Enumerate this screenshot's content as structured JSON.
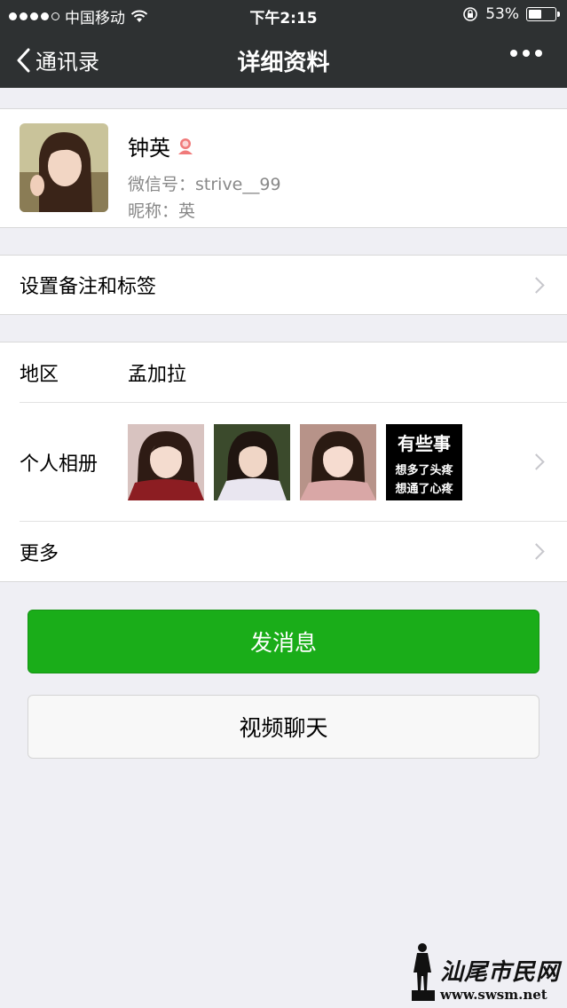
{
  "status_bar": {
    "carrier": "中国移动",
    "time": "下午2:15",
    "battery": "53%",
    "battery_level": 0.53
  },
  "nav": {
    "back_label": "通讯录",
    "title": "详细资料",
    "more_icon": "more-dots-icon"
  },
  "profile": {
    "name": "钟英",
    "wechat_id": "微信号：strive__99",
    "nickname": "昵称：英",
    "gender_icon": "female-icon"
  },
  "rows": {
    "remark_label": "设置备注和标签",
    "region_label": "地区",
    "region_value": "孟加拉",
    "album_label": "个人相册",
    "more_label": "更多"
  },
  "album_text_image": {
    "line1": "有些事",
    "line2": "想多了头疼",
    "line3": "想通了心疼"
  },
  "buttons": {
    "send_message": "发消息",
    "video_chat": "视频聊天"
  },
  "watermark": {
    "site_name": "汕尾市民网",
    "url": "www.swsm.net"
  },
  "colors": {
    "nav_bg": "#2e3132",
    "primary_green": "#1aad19",
    "page_bg": "#efeff4"
  }
}
